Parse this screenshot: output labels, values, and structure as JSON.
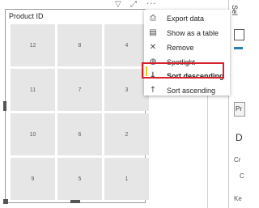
{
  "visual": {
    "title": "Product ID",
    "cells": [
      [
        "12",
        "8",
        "4"
      ],
      [
        "11",
        "7",
        "3"
      ],
      [
        "10",
        "6",
        "2"
      ],
      [
        "9",
        "5",
        "1"
      ]
    ],
    "more_icon": "more-options-icon",
    "filter_icon": "filter-icon",
    "focus_icon": "focus-mode-icon"
  },
  "menu": {
    "items": [
      {
        "label": "Export data",
        "icon": "export-icon"
      },
      {
        "label": "Show as a table",
        "icon": "table-icon"
      },
      {
        "label": "Remove",
        "icon": "close-icon"
      },
      {
        "label": "Spotlight",
        "icon": "spotlight-icon"
      },
      {
        "label": "Sort descending",
        "icon": "sort-descending-icon"
      },
      {
        "label": "Sort ascending",
        "icon": "sort-ascending-icon"
      }
    ],
    "highlight_color": "#d6202a"
  },
  "pane": {
    "rotated_label": "Sel",
    "pr_label": "Pr",
    "d_label": "D",
    "cr_label": "Cr",
    "c_label": "C",
    "ke_label": "Ke"
  }
}
